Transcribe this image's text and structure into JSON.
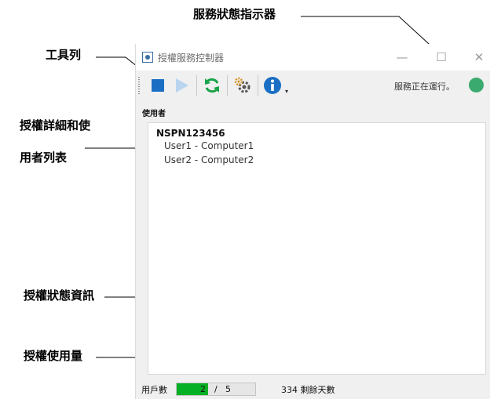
{
  "callouts": {
    "service_status_indicator": "服務狀態指示器",
    "toolbar": "工具列",
    "license_user_list": [
      "授權詳細和使",
      "用者列表"
    ],
    "license_status_info": "授權狀態資訊",
    "license_usage": "授權使用量"
  },
  "window": {
    "title": "授權服務控制器",
    "controls": {
      "minimize": "—",
      "maximize": "☐",
      "close": "✕"
    }
  },
  "toolbar": {
    "buttons": [
      "stop",
      "start",
      "refresh",
      "settings",
      "info"
    ],
    "overflow_glyph": "▾",
    "service_status_text": "服務正在運行。",
    "status_color": "#3aaa6e"
  },
  "user_list": {
    "header": "使用者",
    "root": "NSPN123456",
    "users": [
      "User1 - Computer1",
      "User2 - Computer2"
    ]
  },
  "status_bar": {
    "users_label": "用戶數",
    "used": "2",
    "separator": "/",
    "total": "5",
    "used_fraction": 0.4,
    "days_remaining": "334 剩餘天數"
  }
}
